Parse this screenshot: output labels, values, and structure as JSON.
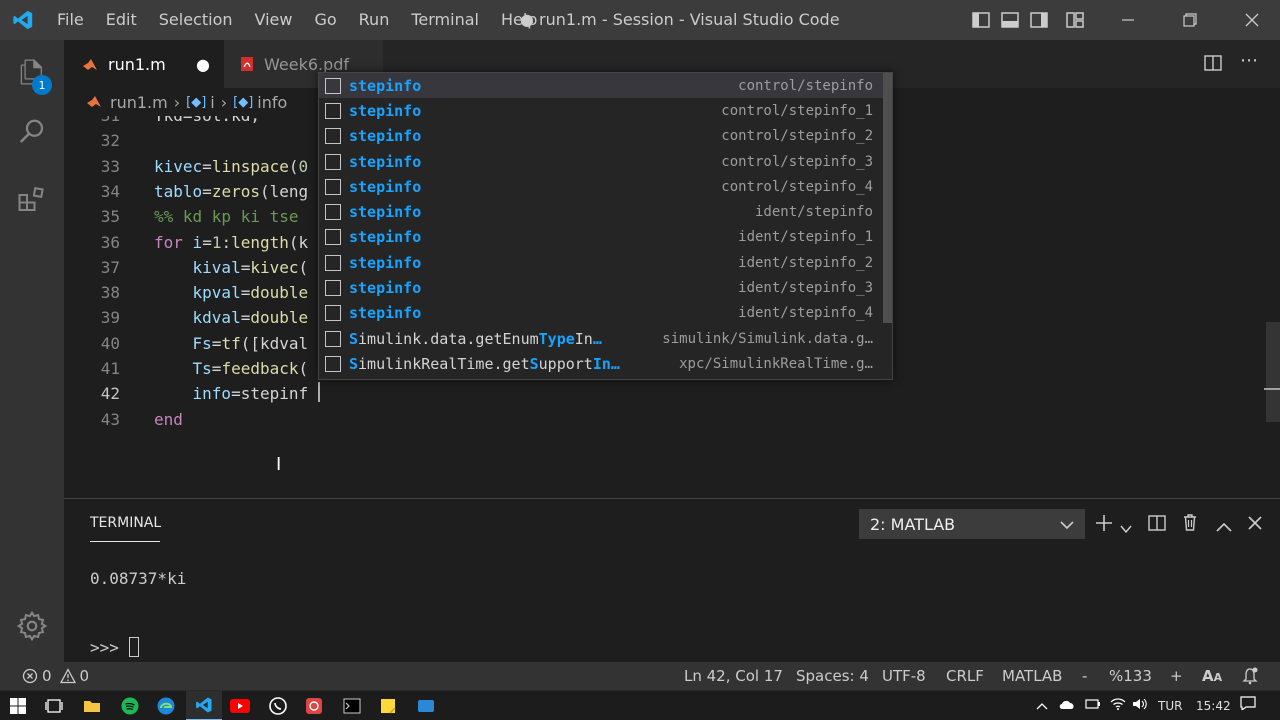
{
  "menu": [
    "File",
    "Edit",
    "Selection",
    "View",
    "Go",
    "Run",
    "Terminal",
    "Help"
  ],
  "window_title": "● run1.m - Session - Visual Studio Code",
  "tabs": [
    {
      "label": "run1.m",
      "modified": "●"
    },
    {
      "label": "Week6.pdf"
    }
  ],
  "breadcrumb": {
    "file": "run1.m",
    "sep": "›",
    "sym1": "i",
    "sym2": "info"
  },
  "activity": {
    "source_control_badge": "1"
  },
  "editor": {
    "lines": [
      {
        "n": "31",
        "tokens": [
          {
            "c": "op",
            "t": "Tkd=sol.kd;"
          }
        ]
      },
      {
        "n": "32",
        "tokens": []
      },
      {
        "n": "33",
        "tokens": [
          {
            "c": "var",
            "t": "kivec"
          },
          {
            "c": "op",
            "t": "="
          },
          {
            "c": "fn",
            "t": "linspace"
          },
          {
            "c": "op",
            "t": "("
          },
          {
            "c": "num",
            "t": "0"
          }
        ]
      },
      {
        "n": "34",
        "tokens": [
          {
            "c": "var",
            "t": "tablo"
          },
          {
            "c": "op",
            "t": "="
          },
          {
            "c": "fn",
            "t": "zeros"
          },
          {
            "c": "op",
            "t": "(leng"
          }
        ]
      },
      {
        "n": "35",
        "tokens": [
          {
            "c": "cmt",
            "t": "%% kd kp ki tse"
          }
        ]
      },
      {
        "n": "36",
        "tokens": [
          {
            "c": "kw",
            "t": "for"
          },
          {
            "c": "op",
            "t": " "
          },
          {
            "c": "var",
            "t": "i"
          },
          {
            "c": "op",
            "t": "="
          },
          {
            "c": "num",
            "t": "1"
          },
          {
            "c": "op",
            "t": ":"
          },
          {
            "c": "fn",
            "t": "length"
          },
          {
            "c": "op",
            "t": "(k"
          }
        ]
      },
      {
        "n": "37",
        "tokens": [
          {
            "c": "op",
            "t": "    "
          },
          {
            "c": "var",
            "t": "kival"
          },
          {
            "c": "op",
            "t": "="
          },
          {
            "c": "fn",
            "t": "kivec"
          },
          {
            "c": "op",
            "t": "("
          }
        ]
      },
      {
        "n": "38",
        "tokens": [
          {
            "c": "op",
            "t": "    "
          },
          {
            "c": "var",
            "t": "kpval"
          },
          {
            "c": "op",
            "t": "="
          },
          {
            "c": "fn",
            "t": "double"
          }
        ]
      },
      {
        "n": "39",
        "tokens": [
          {
            "c": "op",
            "t": "    "
          },
          {
            "c": "var",
            "t": "kdval"
          },
          {
            "c": "op",
            "t": "="
          },
          {
            "c": "fn",
            "t": "double"
          }
        ]
      },
      {
        "n": "40",
        "tokens": [
          {
            "c": "op",
            "t": "    "
          },
          {
            "c": "var",
            "t": "Fs"
          },
          {
            "c": "op",
            "t": "="
          },
          {
            "c": "fn",
            "t": "tf"
          },
          {
            "c": "op",
            "t": "([kdval"
          }
        ]
      },
      {
        "n": "41",
        "tokens": [
          {
            "c": "op",
            "t": "    "
          },
          {
            "c": "var",
            "t": "Ts"
          },
          {
            "c": "op",
            "t": "="
          },
          {
            "c": "fn",
            "t": "feedback"
          },
          {
            "c": "op",
            "t": "("
          }
        ]
      },
      {
        "n": "42",
        "tokens": [
          {
            "c": "op",
            "t": "    "
          },
          {
            "c": "var",
            "t": "info"
          },
          {
            "c": "op",
            "t": "=stepinf"
          }
        ]
      },
      {
        "n": "43",
        "tokens": [
          {
            "c": "kw",
            "t": "end"
          }
        ]
      }
    ]
  },
  "suggestions": [
    {
      "label": "stepinfo",
      "detail": "control/stepinfo",
      "match": "all"
    },
    {
      "label": "stepinfo",
      "detail": "control/stepinfo_1",
      "match": "all"
    },
    {
      "label": "stepinfo",
      "detail": "control/stepinfo_2",
      "match": "all"
    },
    {
      "label": "stepinfo",
      "detail": "control/stepinfo_3",
      "match": "all"
    },
    {
      "label": "stepinfo",
      "detail": "control/stepinfo_4",
      "match": "all"
    },
    {
      "label": "stepinfo",
      "detail": "ident/stepinfo",
      "match": "all"
    },
    {
      "label": "stepinfo",
      "detail": "ident/stepinfo_1",
      "match": "all"
    },
    {
      "label": "stepinfo",
      "detail": "ident/stepinfo_2",
      "match": "all"
    },
    {
      "label": "stepinfo",
      "detail": "ident/stepinfo_3",
      "match": "all"
    },
    {
      "label": "stepinfo",
      "detail": "ident/stepinfo_4",
      "match": "all"
    },
    {
      "label": "Simulink.data.getEnumTypeIn…",
      "detail": "simulink/Simulink.data.g…",
      "match": "partial1"
    },
    {
      "label": "SimulinkRealTime.getSupportIn…",
      "detail": "xpc/SimulinkRealTime.g…",
      "match": "partial2"
    }
  ],
  "panel": {
    "title": "TERMINAL",
    "terminal_select": "2: MATLAB",
    "output_line": "0.08737*ki",
    "prompt": ">>> "
  },
  "status": {
    "errors": "0",
    "warnings": "0",
    "position": "Ln 42, Col 17",
    "spaces": "Spaces: 4",
    "encoding": "UTF-8",
    "eol": "CRLF",
    "language": "MATLAB",
    "zoom_minus": "-",
    "zoom": "%133",
    "zoom_plus": "+"
  },
  "taskbar": {
    "lang": "TUR",
    "time": "15:42"
  },
  "colors": {
    "accent": "#007acc",
    "titlebar": "#3c3c3c",
    "activity": "#333333",
    "editor": "#1e1e1e",
    "match": "#18a3ff"
  }
}
